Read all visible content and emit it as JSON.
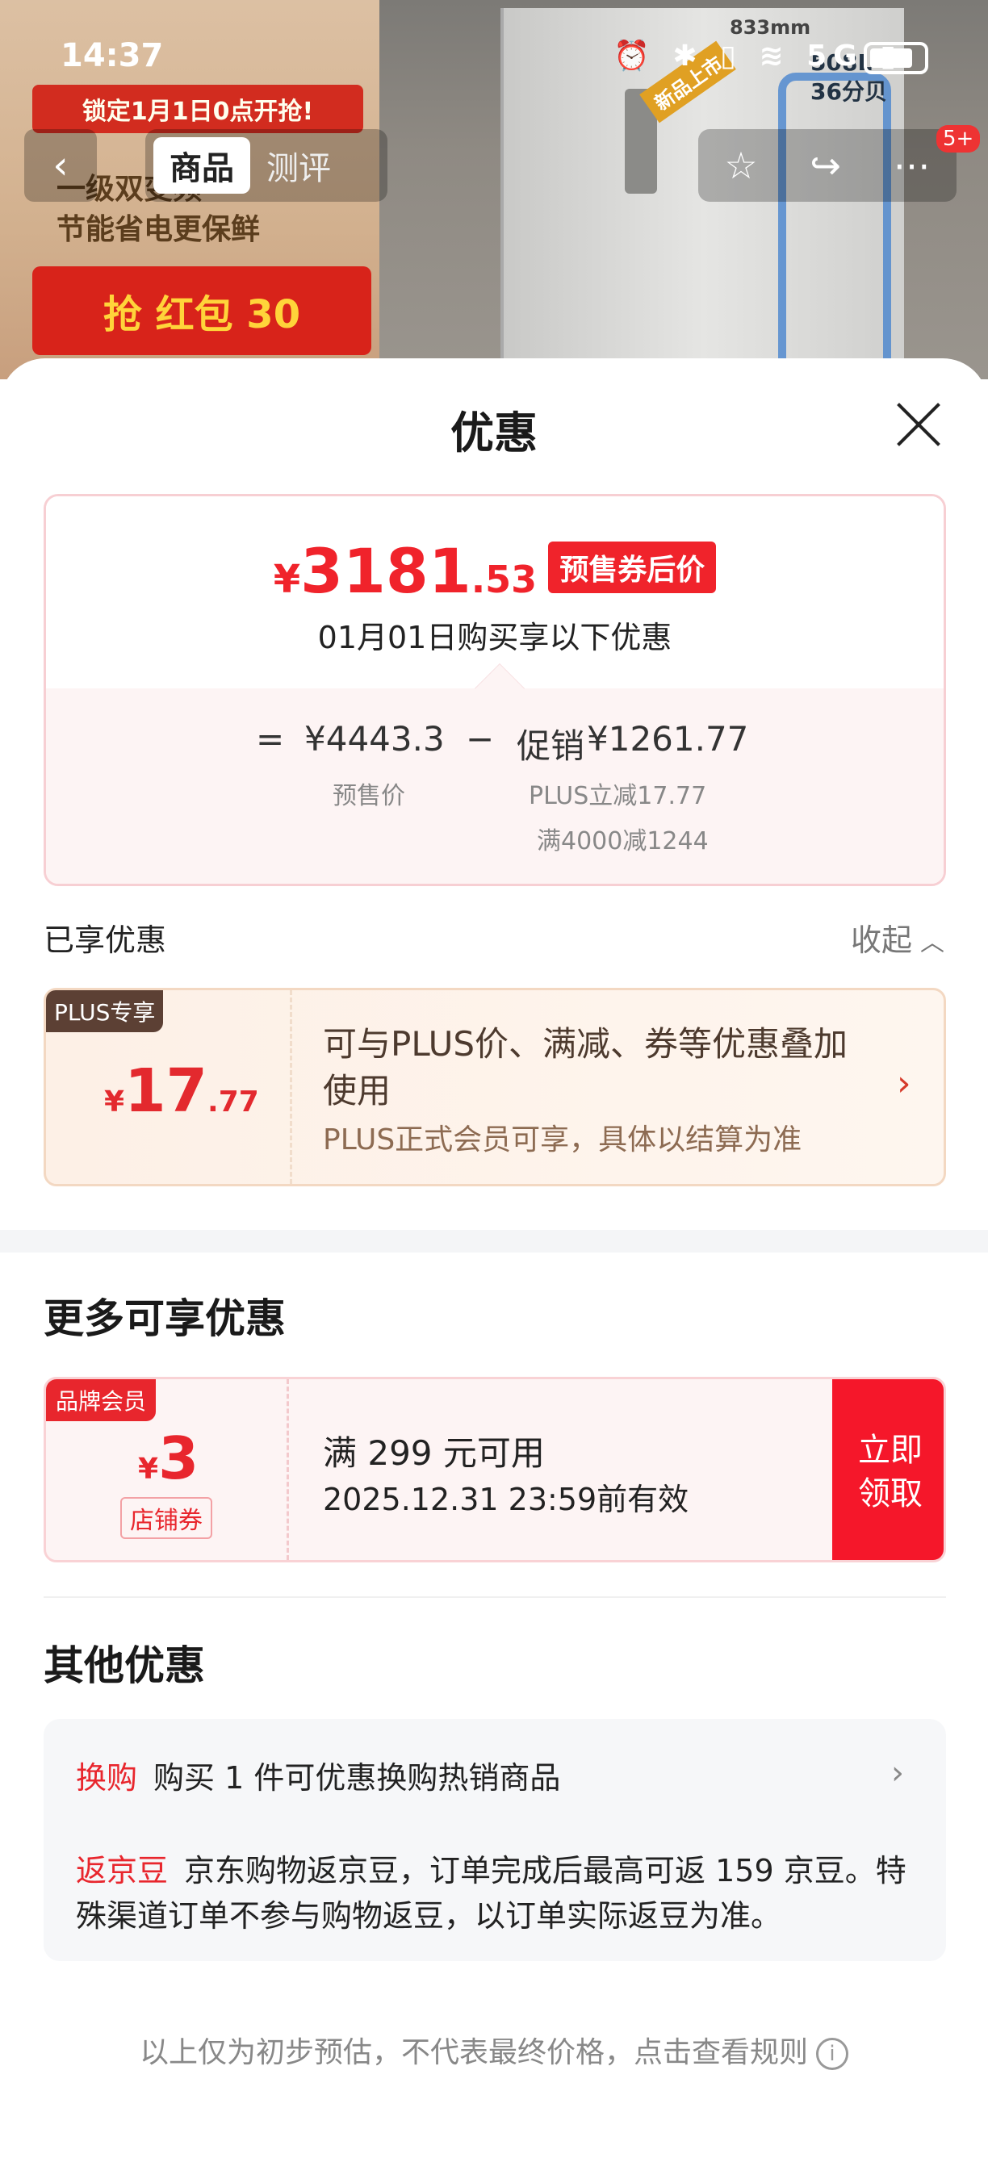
{
  "status_bar": {
    "time": "14:37",
    "icons": "⏰ ✱ ▯ ≋ 5G ▮",
    "signal": "5G"
  },
  "background": {
    "promo_date": "锁定1月1日0点开抢!",
    "promo_lines": [
      "一级双变频",
      "节能省电更保鲜"
    ],
    "promo_red": "抢 红包 30",
    "new_badge": "新品上市",
    "fridge_spec": "508L 36分贝",
    "dimension": "833mm"
  },
  "nav": {
    "back_icon": "‹",
    "tabs": [
      {
        "label": "商品",
        "active": true
      },
      {
        "label": "测评",
        "active": false
      }
    ],
    "right_icons": [
      "☆",
      "↪",
      "⋯"
    ],
    "badge": "5+"
  },
  "sheet": {
    "title": "优惠",
    "price_card": {
      "currency": "¥",
      "price_int": "3181",
      "price_dec": ".53",
      "tag": "预售券后价",
      "subtitle": "01月01日购买享以下优惠",
      "equals": "=",
      "presale_price": "¥4443.3",
      "minus": "−",
      "promo_label": "促销",
      "promo_amount": "¥1261.77",
      "presale_label": "预售价",
      "promo_detail_1": "PLUS立减17.77",
      "promo_detail_2": "满4000减1244"
    },
    "enjoyed_label": "已享优惠",
    "collapse_label": "收起",
    "collapse_icon": "︿",
    "plus_card": {
      "tag": "PLUS专享",
      "currency": "¥",
      "amount_int": "17",
      "amount_dec": ".77",
      "title": "可与PLUS价、满减、券等优惠叠加使用",
      "desc": "PLUS正式会员可享，具体以结算为准",
      "arrow": "›"
    },
    "more_title": "更多可享优惠",
    "coupon": {
      "tag": "品牌会员",
      "currency": "¥",
      "amount": "3",
      "type": "店铺券",
      "condition": "满 299 元可用",
      "validity": "2025.12.31 23:59前有效",
      "button": "立即领取"
    },
    "other_title": "其他优惠",
    "other_items": [
      {
        "label": "换购",
        "text": "购买 1 件可优惠换购热销商品",
        "arrow": "›"
      },
      {
        "label": "返京豆",
        "text": "京东购物返京豆，订单完成后最高可返 159 京豆。特殊渠道订单不参与购物返豆，以订单实际返豆为准。"
      }
    ],
    "footer_note": "以上仅为初步预估，不代表最终价格，点击查看规则",
    "footer_icon": "i"
  }
}
